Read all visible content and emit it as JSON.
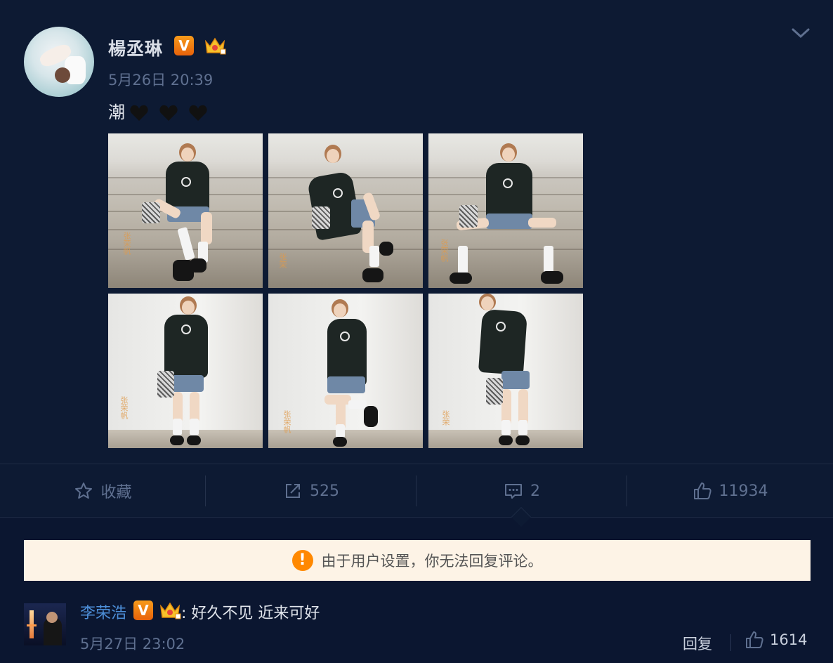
{
  "post": {
    "author": "楊丞琳",
    "time": "5月26日 20:39",
    "text": "潮",
    "hearts": [
      "black-heart",
      "black-heart",
      "black-heart"
    ],
    "photo_count": 6
  },
  "actions": {
    "favorite_label": "收藏",
    "repost_count": "525",
    "comment_count": "2",
    "like_count": "11934"
  },
  "notice": {
    "text": "由于用户设置，你无法回复评论。",
    "icon": "!"
  },
  "comment": {
    "author": "李荣浩",
    "separator": ":",
    "text": "好久不见 近来可好",
    "time": "5月27日 23:02",
    "reply_label": "回复",
    "like_count": "1614"
  },
  "badges": {
    "verified": "V"
  },
  "colors": {
    "background": "#0d1a33",
    "link": "#4d8fd9",
    "muted": "#5f7090",
    "verified": "#f07a12",
    "notice_bg": "#fdf3e6",
    "warning": "#ff8800"
  }
}
